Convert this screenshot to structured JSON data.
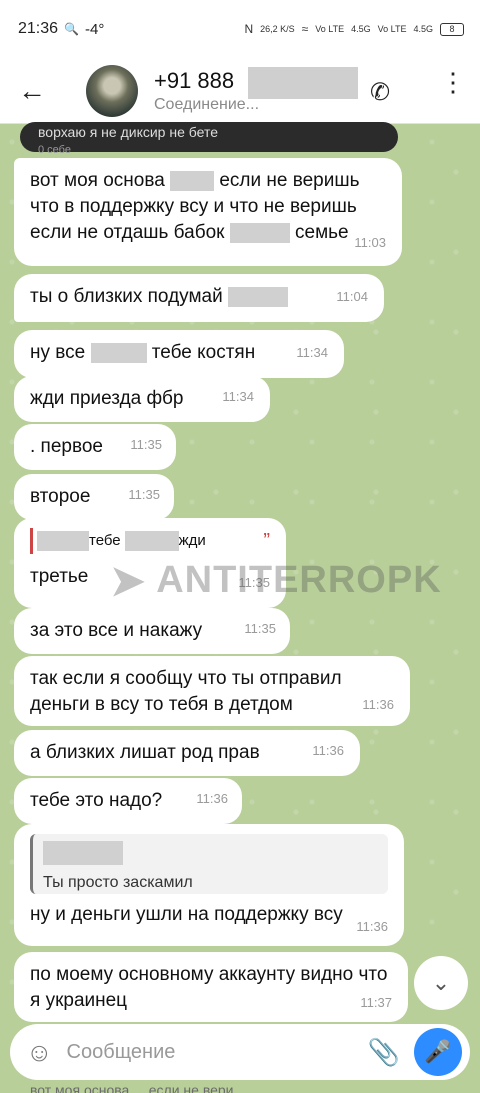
{
  "status": {
    "time": "21:36",
    "search_icon": "search-icon",
    "temp": "-4°",
    "net_speed": "26,2 K/S",
    "net1": "Vo LTE",
    "net2": "4.5G",
    "net3": "Vo LTE",
    "net4": "4.5G",
    "battery": "8"
  },
  "header": {
    "back_icon": "arrow-left-icon",
    "name": "+91 888",
    "status": "Соединение..."
  },
  "messages": [
    {
      "text_parts": [
        "вот моя основа",
        "если не веришь что в поддержку всу и что не веришь если не отдашь бабок",
        "семье"
      ],
      "time": "11:03"
    },
    {
      "text": "ты о близких подумай",
      "time": "11:04"
    },
    {
      "text_a": "ну все",
      "text_b": "тебе костян",
      "time": "11:34"
    },
    {
      "text": "жди приезда фбр",
      "time": "11:34"
    },
    {
      "text": ". первое",
      "time": "11:35"
    },
    {
      "text": "второе",
      "time": "11:35"
    },
    {
      "quote_a": "тебе",
      "quote_b": "жди",
      "text": "третье",
      "time": "11:35"
    },
    {
      "text": "за это все и накажу",
      "time": "11:35"
    },
    {
      "text": "так если я сообщу что ты отправил деньги в всу то тебя в детдом",
      "time": "11:36"
    },
    {
      "text": "а близких лишат род прав",
      "time": "11:36"
    },
    {
      "text": "тебе это надо?",
      "time": "11:36"
    },
    {
      "reply": "Ты просто заскамил",
      "text": "ну и деньги ушли на поддержку всу",
      "time": "11:36"
    },
    {
      "text": "по моему основному аккаунту видно что я украинец",
      "time": "11:37"
    }
  ],
  "top_cut_text": "ворхаю я не диксир не бете",
  "top_cut_time": "0 себе",
  "watermark": "ANTITERROPK",
  "input": {
    "placeholder": "Сообщение"
  },
  "preview": "вот моя основа ... если не вери..."
}
